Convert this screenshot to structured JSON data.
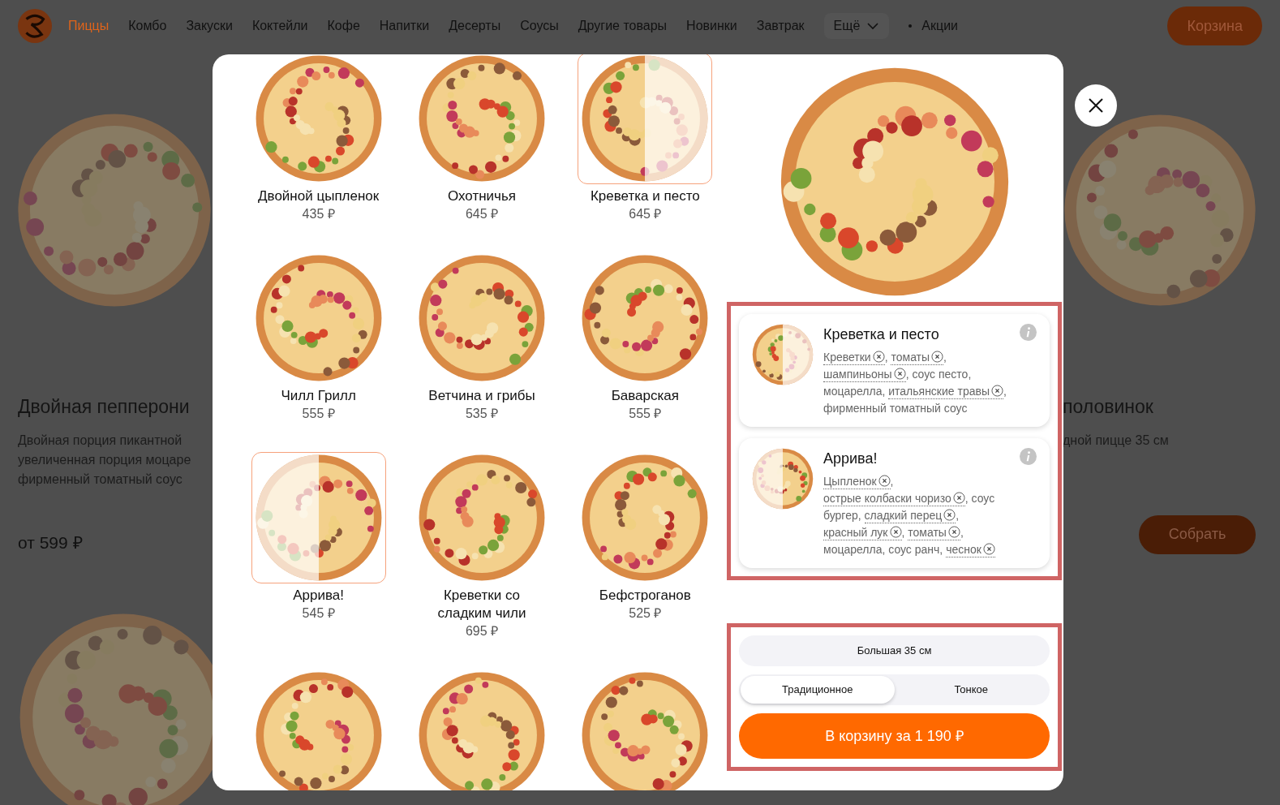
{
  "nav": {
    "items": [
      {
        "label": "Пиццы",
        "selected": true
      },
      {
        "label": "Комбо",
        "selected": false
      },
      {
        "label": "Закуски",
        "selected": false
      },
      {
        "label": "Коктейли",
        "selected": false
      },
      {
        "label": "Кофе",
        "selected": false
      },
      {
        "label": "Напитки",
        "selected": false
      },
      {
        "label": "Десерты",
        "selected": false
      },
      {
        "label": "Соусы",
        "selected": false
      },
      {
        "label": "Другие товары",
        "selected": false
      },
      {
        "label": "Новинки",
        "selected": false
      },
      {
        "label": "Завтрак",
        "selected": false
      }
    ],
    "more": "Ещё",
    "promo": "Акции",
    "cart": "Корзина"
  },
  "background": {
    "left": {
      "title": "Двойная пепперони",
      "description": [
        "Двойная порция пикантной",
        "увеличенная порция моцаре",
        "фирменный томатный соус"
      ],
      "price": "от 599 ₽"
    },
    "right": {
      "title": "половинок",
      "description": "дной пицце 35 см",
      "button": "Собрать"
    }
  },
  "modal": {
    "pizzas": [
      {
        "name": "Двойной цыпленок",
        "price": "435 ₽",
        "selected": false
      },
      {
        "name": "Охотничья",
        "price": "645 ₽",
        "selected": false
      },
      {
        "name": "Креветка и песто",
        "price": "645 ₽",
        "selected": true
      },
      {
        "name": "Чилл Грилл",
        "price": "555 ₽",
        "selected": false
      },
      {
        "name": "Ветчина и грибы",
        "price": "535 ₽",
        "selected": false
      },
      {
        "name": "Баварская",
        "price": "555 ₽",
        "selected": false
      },
      {
        "name": "Аррива!",
        "price": "545 ₽",
        "selected": true
      },
      {
        "name": "Креветки со сладким чили",
        "price": "695 ₽",
        "selected": false
      },
      {
        "name": "Бефстроганов",
        "price": "525 ₽",
        "selected": false
      },
      {
        "selected": false
      },
      {
        "selected": false
      },
      {
        "selected": false
      }
    ],
    "halves": [
      {
        "title": "Креветка и песто",
        "ingredients": [
          {
            "text": "Креветки",
            "removable": true,
            "sep": ","
          },
          {
            "text": "томаты",
            "removable": true,
            "sep": ","
          },
          {
            "text": "шампиньоны",
            "removable": true,
            "sep": ","
          },
          {
            "text": "соус песто",
            "removable": false,
            "sep": ","
          },
          {
            "text": "моцарелла",
            "removable": false,
            "sep": ","
          },
          {
            "text": "итальянские травы",
            "removable": true,
            "sep": ","
          },
          {
            "text": "фирменный томатный соус",
            "removable": false
          }
        ]
      },
      {
        "title": "Аррива!",
        "ingredients": [
          {
            "text": "Цыпленок",
            "removable": true,
            "sep": ","
          },
          {
            "text": "острые колбаски чоризо",
            "removable": true,
            "sep": ","
          },
          {
            "text": "соус бургер",
            "removable": false,
            "sep": ","
          },
          {
            "text": "сладкий перец",
            "removable": true,
            "sep": ","
          },
          {
            "text": "красный лук",
            "removable": true,
            "sep": ","
          },
          {
            "text": "томаты",
            "removable": true,
            "sep": ","
          },
          {
            "text": "моцарелла",
            "removable": false,
            "sep": ","
          },
          {
            "text": "соус ранч",
            "removable": false,
            "sep": ","
          },
          {
            "text": "чеснок",
            "removable": true
          }
        ]
      }
    ],
    "size": "Большая 35 см",
    "crust": [
      {
        "label": "Традиционное",
        "selected": true
      },
      {
        "label": "Тонкое",
        "selected": false
      }
    ],
    "add_button": "В корзину за 1 190 ₽"
  }
}
